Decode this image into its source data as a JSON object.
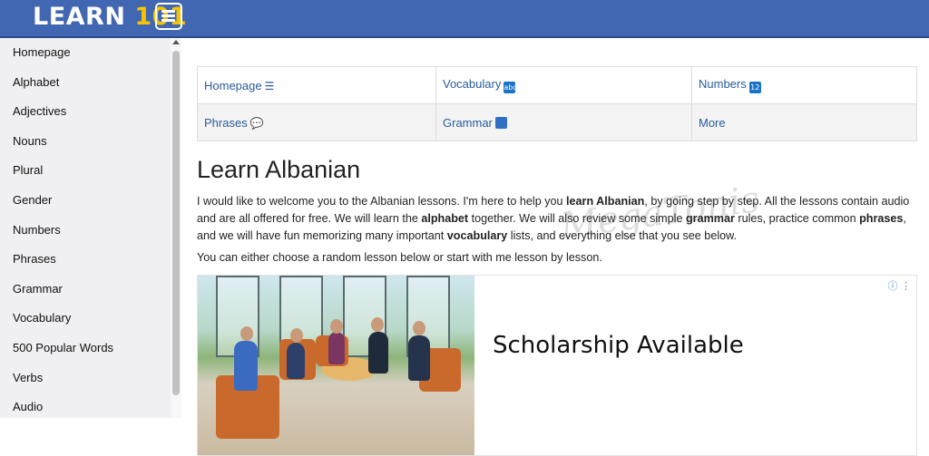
{
  "brand": {
    "text_a": "LEARN",
    "text_b": "101"
  },
  "sidebar": {
    "items": [
      {
        "label": "Homepage"
      },
      {
        "label": "Alphabet"
      },
      {
        "label": "Adjectives"
      },
      {
        "label": "Nouns"
      },
      {
        "label": "Plural"
      },
      {
        "label": "Gender"
      },
      {
        "label": "Numbers"
      },
      {
        "label": "Phrases"
      },
      {
        "label": "Grammar"
      },
      {
        "label": "Vocabulary"
      },
      {
        "label": "500 Popular Words"
      },
      {
        "label": "Verbs"
      },
      {
        "label": "Audio"
      }
    ]
  },
  "nav": {
    "row1": [
      {
        "label": "Homepage",
        "icon": "☰"
      },
      {
        "label": "Vocabulary",
        "icon": "abc"
      },
      {
        "label": "Numbers",
        "icon": "1234"
      }
    ],
    "row2": [
      {
        "label": "Phrases",
        "icon": "speech-bubble"
      },
      {
        "label": "Grammar",
        "icon": "book"
      },
      {
        "label": "More",
        "icon": ""
      }
    ]
  },
  "main": {
    "title": "Learn Albanian",
    "intro": [
      {
        "t": "I would like to welcome you to the Albanian lessons. I'm here to help you ",
        "b": false
      },
      {
        "t": "learn Albanian",
        "b": true
      },
      {
        "t": ", by going step by step. All the lessons contain audio and are all offered for free. We will learn the ",
        "b": false
      },
      {
        "t": "alphabet",
        "b": true
      },
      {
        "t": " together. We will also review some simple ",
        "b": false
      },
      {
        "t": "grammar",
        "b": true
      },
      {
        "t": " rules, practice common ",
        "b": false
      },
      {
        "t": "phrases",
        "b": true
      },
      {
        "t": ", and we will have fun memorizing many important ",
        "b": false
      },
      {
        "t": "vocabulary",
        "b": true
      },
      {
        "t": " lists, and everything else that you see below.",
        "b": false
      }
    ],
    "choose": "You can either choose a random lesson below or start with me lesson by lesson.",
    "watermark": "MegaTonis"
  },
  "ad": {
    "headline": "Scholarship Available",
    "adchoice": "ⓘ ⋮"
  },
  "colors": {
    "topbar": "#4267b2",
    "link": "#2a5c9c",
    "brand_accent": "#f5c400"
  }
}
